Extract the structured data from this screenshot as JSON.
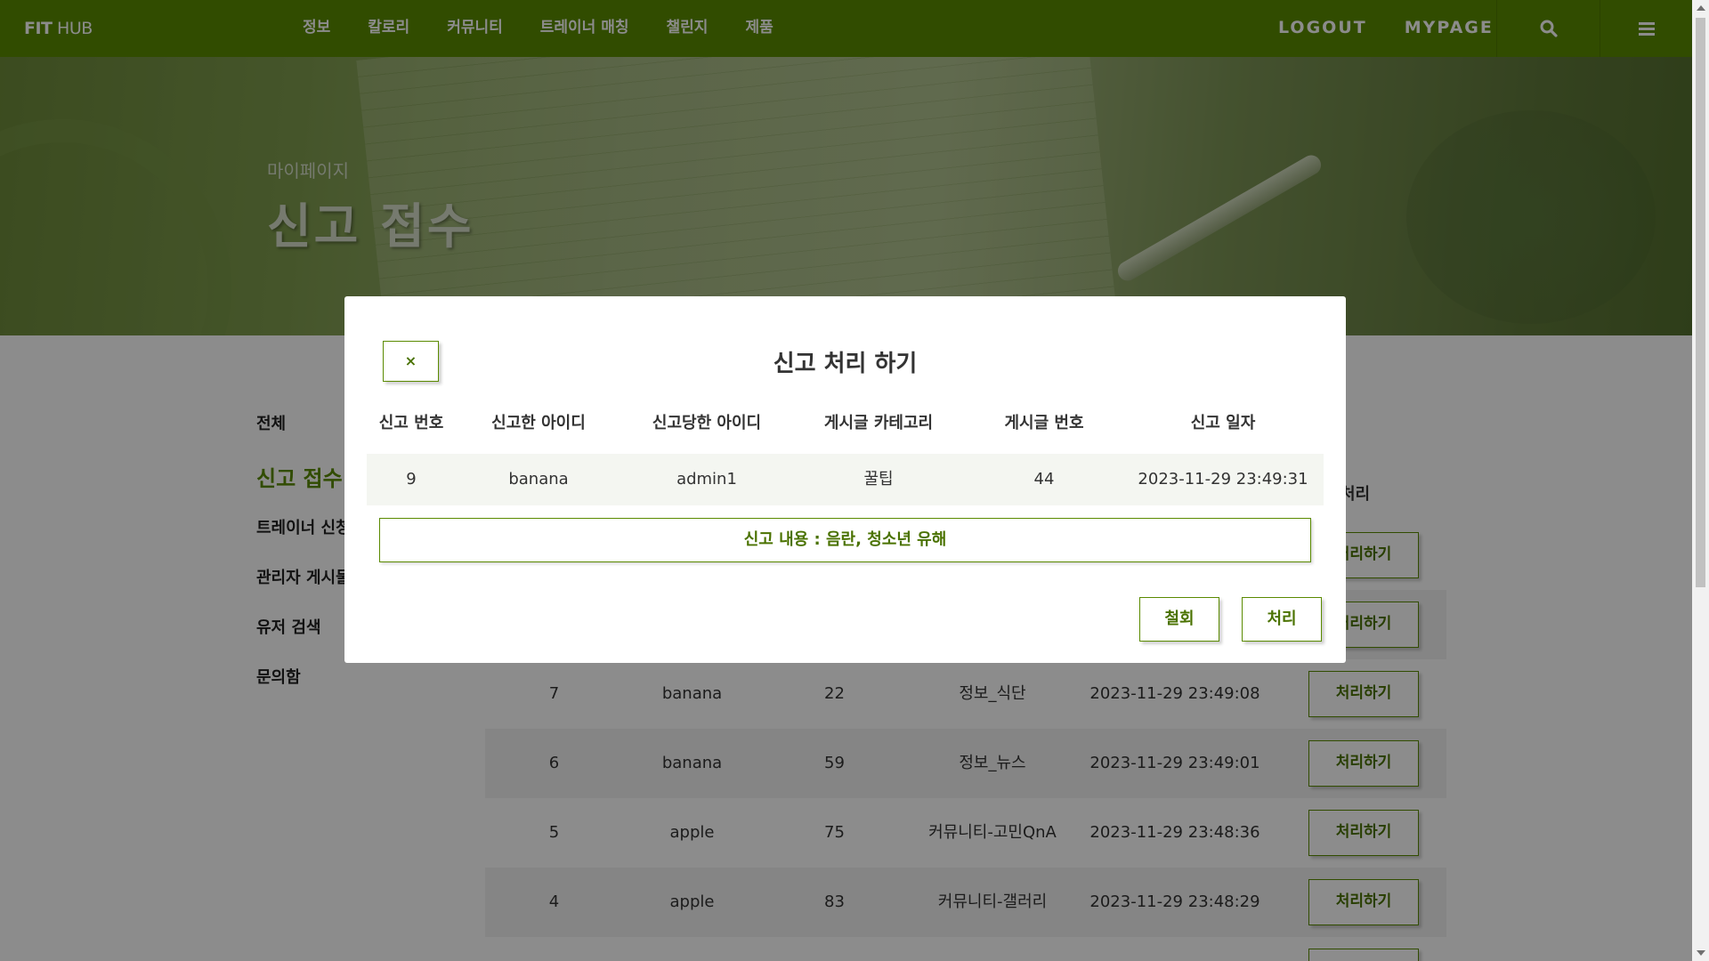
{
  "nav": {
    "brand_bold": "FIT",
    "brand_rest": " HUB",
    "menu": [
      "정보",
      "칼로리",
      "커뮤니티",
      "트레이너 매칭",
      "챌린지",
      "제품"
    ],
    "right": [
      "LOGOUT",
      "MYPAGE"
    ],
    "icons": [
      "search-icon",
      "hamburger-menu-icon"
    ]
  },
  "hero": {
    "subtitle": "마이페이지",
    "title": "신고 접수"
  },
  "sidebar": {
    "items": [
      "전체",
      "신고 접수",
      "트레이너 신청",
      "관리자 게시물",
      "유저 검색",
      "문의함"
    ]
  },
  "table": {
    "action_header": "처리",
    "rows": [
      {
        "no": "",
        "reporter": "",
        "post_no": "",
        "category": "",
        "date": "",
        "action": "처리하기"
      },
      {
        "no": "",
        "reporter": "",
        "post_no": "",
        "category": "",
        "date": "",
        "action": "처리하기"
      },
      {
        "no": "7",
        "reporter": "banana",
        "post_no": "22",
        "category": "정보_식단",
        "date": "2023-11-29 23:49:08",
        "action": "처리하기"
      },
      {
        "no": "6",
        "reporter": "banana",
        "post_no": "59",
        "category": "정보_뉴스",
        "date": "2023-11-29 23:49:01",
        "action": "처리하기"
      },
      {
        "no": "5",
        "reporter": "apple",
        "post_no": "75",
        "category": "커뮤니티-고민QnA",
        "date": "2023-11-29 23:48:36",
        "action": "처리하기"
      },
      {
        "no": "4",
        "reporter": "apple",
        "post_no": "83",
        "category": "커뮤니티-갤러리",
        "date": "2023-11-29 23:48:29",
        "action": "처리하기"
      }
    ]
  },
  "modal": {
    "close_label": "×",
    "title": "신고 처리 하기",
    "headers": [
      "신고 번호",
      "신고한 아이디",
      "신고당한 아이디",
      "게시글 카테고리",
      "게시글 번호",
      "신고 일자"
    ],
    "row": [
      "9",
      "banana",
      "admin1",
      "꿀팁",
      "44",
      "2023-11-29 23:49:31"
    ],
    "content": "신고 내용 : 음란, 청소년 유해",
    "withdraw_label": "철회",
    "process_label": "처리"
  },
  "colors": {
    "brand": "#5a8a00",
    "overlay": "rgba(0,0,0,0.45)"
  }
}
